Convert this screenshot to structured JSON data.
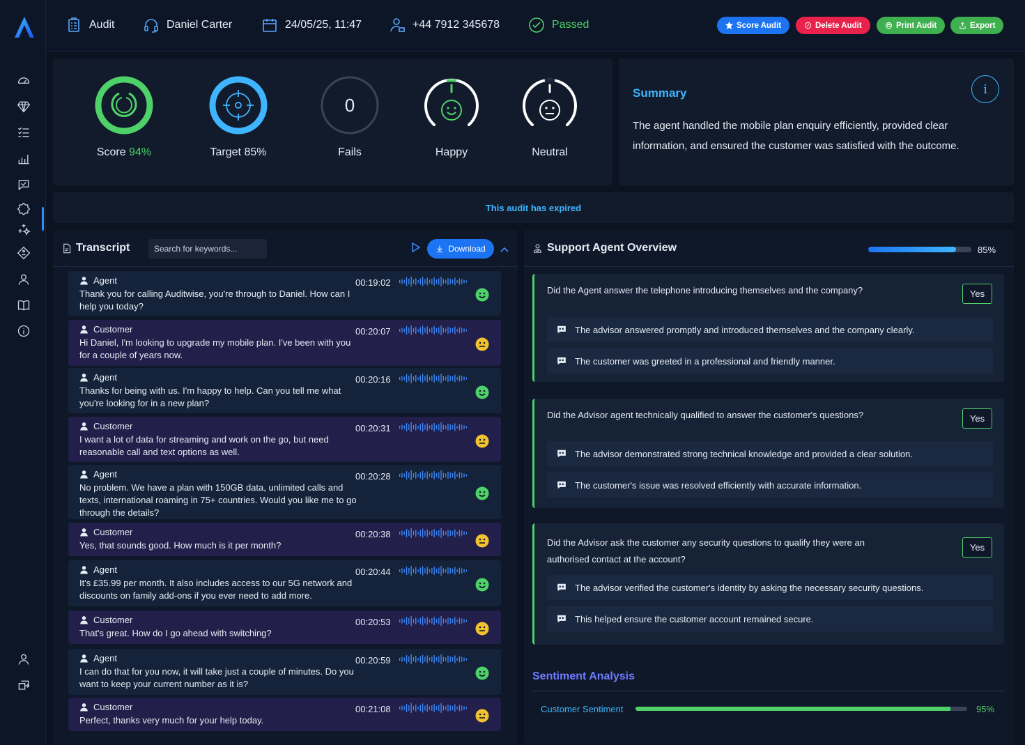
{
  "header": {
    "section": "Audit",
    "agent_name": "Daniel Carter",
    "datetime": "24/05/25, 11:47",
    "phone": "+44 7912 345678",
    "status": "Passed",
    "buttons": {
      "score": "Score Audit",
      "delete": "Delete Audit",
      "print": "Print Audit",
      "export": "Export"
    }
  },
  "kpis": {
    "score_label": "Score",
    "score_value": "94%",
    "target_label": "Target 85%",
    "fails_value": "0",
    "fails_label": "Fails",
    "happy_label": "Happy",
    "neutral_label": "Neutral"
  },
  "summary": {
    "title": "Summary",
    "info_icon": "i",
    "text": "The agent handled the mobile plan enquiry efficiently, provided clear information, and ensured the customer was satisfied with the outcome."
  },
  "expired_notice": "This audit has expired",
  "transcript": {
    "title": "Transcript",
    "search_placeholder": "Search for keywords...",
    "download_label": "Download",
    "messages": [
      {
        "speaker": "Agent",
        "time": "00:19:02",
        "text": "Thank you for calling Auditwise, you're through to Daniel. How can I help you today?",
        "sentiment": "happy"
      },
      {
        "speaker": "Customer",
        "time": "00:20:07",
        "text": "Hi Daniel, I'm looking to upgrade my mobile plan. I've been with you for a couple of years now.",
        "sentiment": "neutral"
      },
      {
        "speaker": "Agent",
        "time": "00:20:16",
        "text": "Thanks for being with us. I'm happy to help. Can you tell me what you're looking for in a new plan?",
        "sentiment": "happy"
      },
      {
        "speaker": "Customer",
        "time": "00:20:31",
        "text": "I want a lot of data for streaming and work on the go, but need reasonable call and text options as well.",
        "sentiment": "neutral"
      },
      {
        "speaker": "Agent",
        "time": "00:20:28",
        "text": "No problem. We have a plan with 150GB data, unlimited calls and texts, international roaming in 75+ countries. Would you like me to go through the details?",
        "sentiment": "happy"
      },
      {
        "speaker": "Customer",
        "time": "00:20:38",
        "text": "Yes, that sounds good. How much is it per month?",
        "sentiment": "neutral"
      },
      {
        "speaker": "Agent",
        "time": "00:20:44",
        "text": "It's £35.99 per month. It also includes access to our 5G network and discounts on family add-ons if you ever need to add more.",
        "sentiment": "happy"
      },
      {
        "speaker": "Customer",
        "time": "00:20:53",
        "text": "That's great. How do I go ahead with switching?",
        "sentiment": "neutral"
      },
      {
        "speaker": "Agent",
        "time": "00:20:59",
        "text": "I can do that for you now, it will take just a couple of minutes. Do you want to keep your current number as it is?",
        "sentiment": "happy"
      },
      {
        "speaker": "Customer",
        "time": "00:21:08",
        "text": "Perfect, thanks very much for your help today.",
        "sentiment": "neutral"
      }
    ]
  },
  "overview": {
    "title": "Support Agent Overview",
    "progress": 0.85,
    "progress_label": "85%",
    "questions": [
      {
        "question": "Did the Agent answer the telephone introducing themselves and the company?",
        "answer": "Yes",
        "notes": [
          "The advisor answered promptly and introduced themselves and the company clearly.",
          "The customer was greeted in a professional and friendly manner."
        ]
      },
      {
        "question": "Did the Advisor agent technically qualified to answer the customer's questions?",
        "answer": "Yes",
        "notes": [
          "The advisor demonstrated strong technical knowledge and provided a clear solution.",
          "The customer's issue was resolved efficiently with accurate information."
        ]
      },
      {
        "question": "Did the Advisor ask the customer any security questions to qualify they were an authorised contact at the account?",
        "answer": "Yes",
        "notes": [
          "The advisor verified the customer's identity by asking the necessary security questions.",
          "This helped ensure the customer account remained secure."
        ]
      }
    ]
  },
  "sentiment": {
    "title": "Sentiment Analysis",
    "customer_label": "Customer Sentiment",
    "customer_value": 0.95,
    "customer_pct": "95%"
  },
  "colors": {
    "accent_blue": "#1d74f2",
    "cyan": "#3fb5ff",
    "green": "#4fd16a",
    "red": "#e8224a",
    "agent_bg": "#15233a",
    "customer_bg": "#221f4a"
  },
  "icons": {
    "sidebar": [
      "dashboard-icon",
      "diamond-icon",
      "checklist-icon",
      "analytics-icon",
      "chat-check-icon",
      "settings-badge-icon",
      "sparkle-icon",
      "tag-icon",
      "user-icon",
      "book-icon",
      "info-icon",
      "profile-icon",
      "logout-icon"
    ]
  }
}
